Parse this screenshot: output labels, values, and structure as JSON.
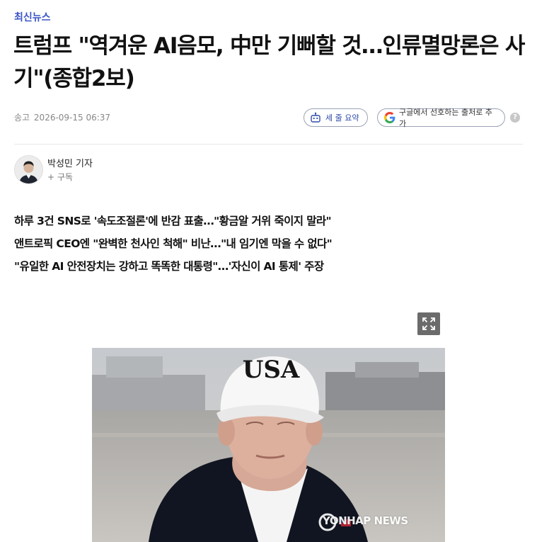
{
  "category": "최신뉴스",
  "headline": "트럼프 \"역겨운 AI음모, 中만 기뻐할 것…인류멸망론은 사기\"(종합2보)",
  "meta": {
    "label": "송고",
    "datetime": "2026-09-15 06:37"
  },
  "actions": {
    "summary_button": "세 줄 요약",
    "google_button": "구글에서 선호하는 출처로 추가",
    "help": "?"
  },
  "reporter": {
    "name": "박성민 기자",
    "subscribe": "+ 구독"
  },
  "summary_lines": [
    "하루 3건 SNS로 '속도조절론'에 반감 표출…\"황금알 거위 죽이지 말라\"",
    "앤트로픽 CEO엔 \"완벽한 천사인 척해\" 비난…\"내 임기엔 막을 수 없다\"",
    "\"유일한 AI 안전장치는 강하고 똑똑한 대통령\"…'자신이 AI 통제' 주장"
  ],
  "photo": {
    "cap_text": "USA",
    "watermark": "YONHAP NEWS"
  },
  "colors": {
    "accent": "#3b55c6",
    "summary_button": "#2f4ba8",
    "text": "#111111",
    "muted": "#888888"
  },
  "icons": [
    "robot-icon",
    "google-logo-icon",
    "help-icon",
    "expand-icon",
    "reporter-avatar"
  ]
}
